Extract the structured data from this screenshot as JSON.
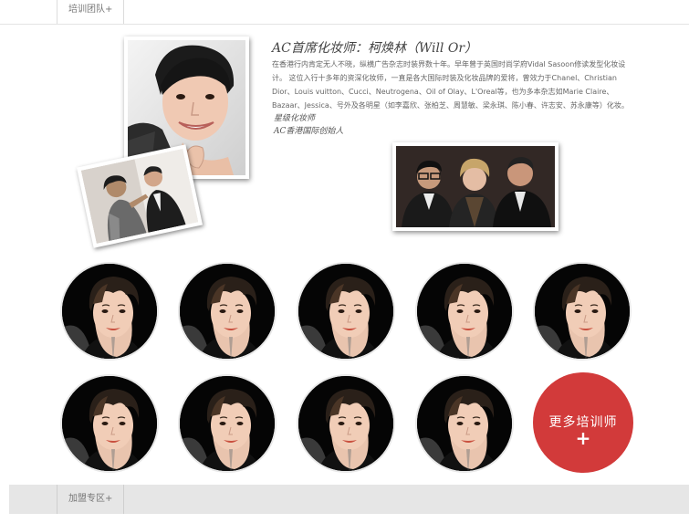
{
  "top_tab": {
    "label": "培训团队+"
  },
  "bottom_tab": {
    "label": "加盟专区+"
  },
  "headline": "AC首席化妆师：柯焕林（Will Or）",
  "bio": "在香港行内肯定无人不晓，纵横广告杂志时装界数十年。早年曾于英国时尚学府Vidal Sasoon修读发型化妆设计。 这位入行十多年的资深化妆师，一直是各大国际时装及化妆品牌的爱将，曾效力于Chanel、Christian Dior、Louis vuitton、Cucci、Neutrogena、Oil of Olay、L'Oreal等，也为多本杂志如Marie Claire、Bazaar、Jessica、号外及各明星（如李嘉欣、张柏芝、周慧敏、梁永琪、陈小春、许志安、苏永康等）化妆。",
  "signature": {
    "line1": "星级化妆师",
    "line2": "AC香港国际创始人"
  },
  "more_button": {
    "label": "更多培训师",
    "icon": "plus-icon"
  },
  "colors": {
    "accent": "#d23a3a",
    "bar": "#e6e6e6"
  }
}
